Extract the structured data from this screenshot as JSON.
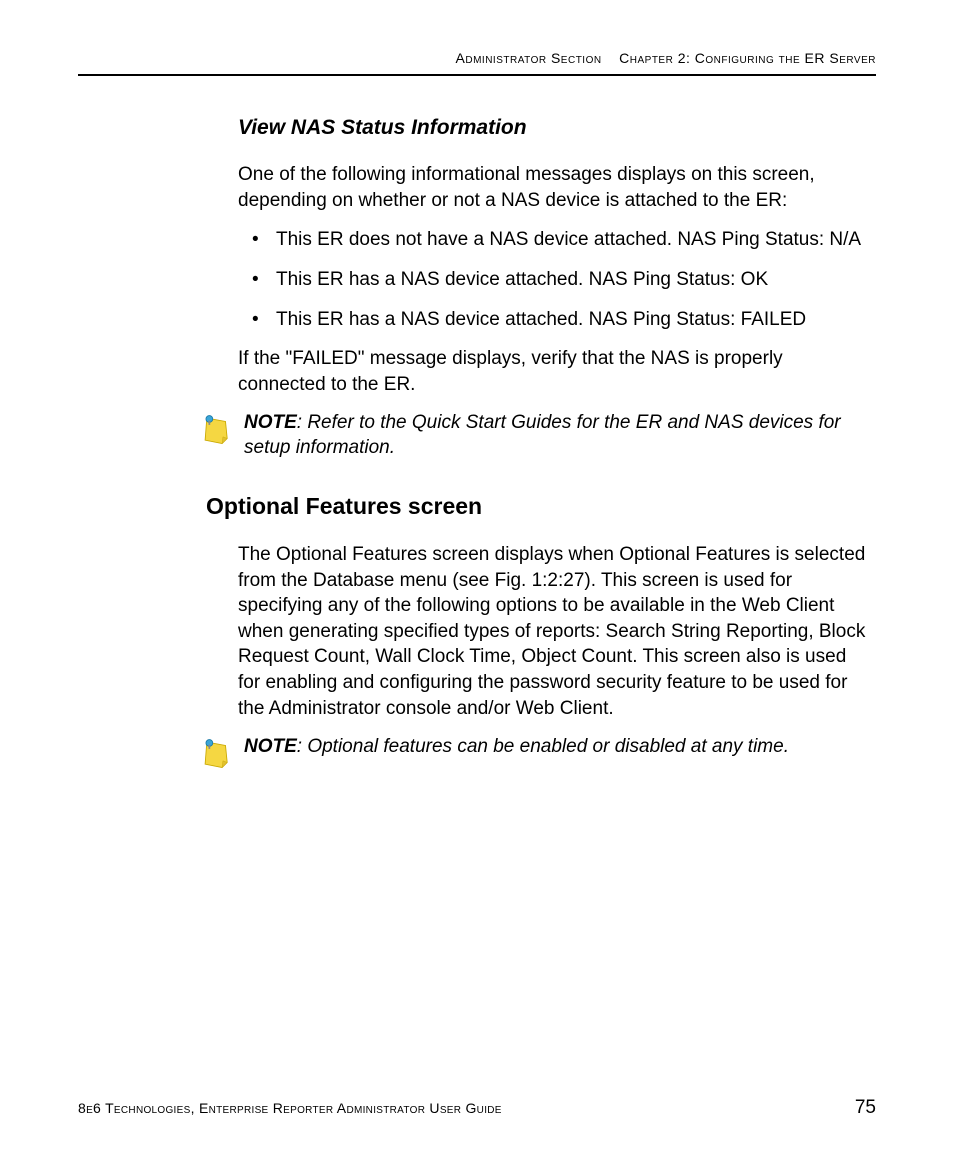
{
  "header": {
    "section": "Administrator Section",
    "chapter": "Chapter 2: Configuring the ER Server"
  },
  "section1": {
    "heading": "View NAS Status Information",
    "para1": "One of the following informational messages displays on this screen, depending on whether or not a NAS device is attached to the ER:",
    "bullets": [
      "This ER does not have a NAS device attached. NAS Ping Status: N/A",
      "This ER has a NAS device attached. NAS Ping Status: OK",
      "This ER has a NAS device attached. NAS Ping Status: FAILED"
    ],
    "para2": "If the \"FAILED\" message displays, verify that the NAS is properly connected to the ER."
  },
  "note1": {
    "label": "NOTE",
    "body": ": Refer to the Quick Start Guides for the ER and NAS devices for setup information."
  },
  "section2": {
    "heading": "Optional Features screen",
    "para1": "The Optional Features screen displays when Optional Features is selected from the Database menu (see Fig. 1:2:27). This screen is used for specifying any of the following options to be available in the Web Client when generating specified types of reports: Search String Reporting, Block Request Count, Wall Clock Time, Object Count. This screen also is used for enabling and configuring the password security feature to be used for the Administrator console and/or Web Client."
  },
  "note2": {
    "label": "NOTE",
    "body": ": Optional features can be enabled or disabled at any time."
  },
  "footer": {
    "left": "8e6 Technologies, Enterprise Reporter Administrator User Guide",
    "pageNumber": "75"
  }
}
